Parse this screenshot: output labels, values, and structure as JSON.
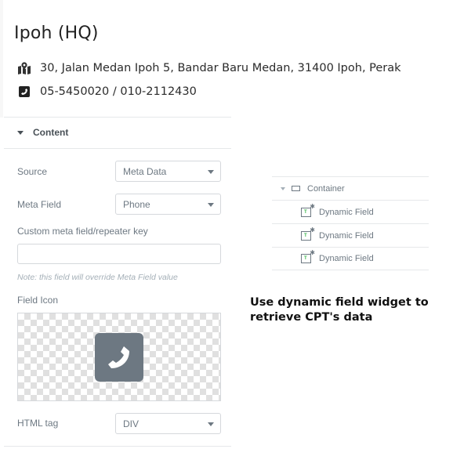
{
  "location": {
    "title": "Ipoh (HQ)",
    "address": "30, Jalan Medan Ipoh 5, Bandar Baru Medan, 31400 Ipoh, Perak",
    "address_icon": "map-marker-icon",
    "phone": "05-5450020 / 010-2112430",
    "phone_icon": "phone-square-icon"
  },
  "panel": {
    "section_title": "Content",
    "source": {
      "label": "Source",
      "value": "Meta Data"
    },
    "meta_field": {
      "label": "Meta Field",
      "value": "Phone"
    },
    "custom_key": {
      "label": "Custom meta field/repeater key",
      "value": "",
      "placeholder": ""
    },
    "note": "Note: this field will override Meta Field value",
    "field_icon": {
      "label": "Field Icon",
      "icon": "phone-square-icon"
    },
    "html_tag": {
      "label": "HTML tag",
      "value": "DIV"
    }
  },
  "navigator": {
    "container_label": "Container",
    "items": [
      {
        "label": "Dynamic Field"
      },
      {
        "label": "Dynamic Field"
      },
      {
        "label": "Dynamic Field"
      }
    ]
  },
  "caption": "Use dynamic field widget to retrieve CPT's data",
  "colors": {
    "accent_icon_bg": "#6d7882",
    "widget_glyph": "#39b54a"
  }
}
